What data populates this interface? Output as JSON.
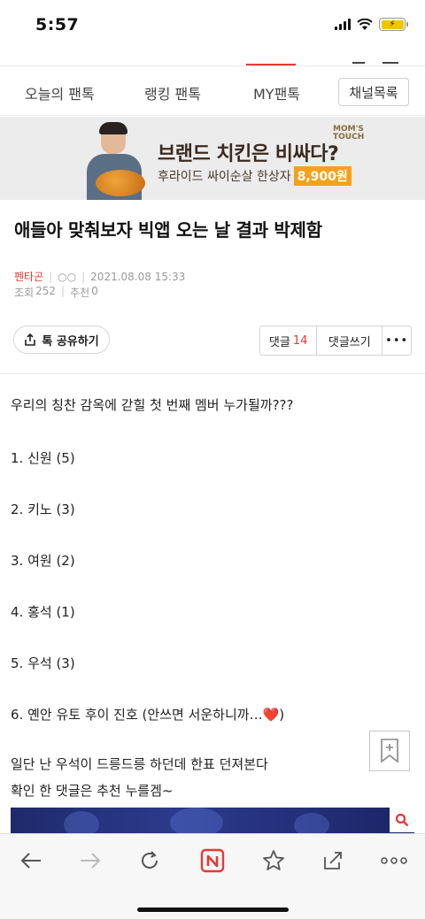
{
  "status": {
    "time": "5:57"
  },
  "tabs": {
    "items": [
      {
        "label": "오늘의 팬톡"
      },
      {
        "label": "랭킹 팬톡"
      },
      {
        "label": "MY팬톡"
      }
    ],
    "active_index": 2,
    "channel_button": "채널목록"
  },
  "ad": {
    "logo": "MOM'S TOUCH",
    "headline": "브랜드 치킨은 비싸다?",
    "sub": "후라이드 싸이순살 한상자",
    "price": "8,900원"
  },
  "post": {
    "title": "애들아 맞춰보자 빅앱 오는 날 결과 박제함",
    "author": "펜타곤",
    "author_extra": "○○",
    "date": "2021.08.08 15:33",
    "views_label": "조회",
    "views": "252",
    "recommend_label": "추천",
    "recommend": "0"
  },
  "actions": {
    "share": "톡 공유하기",
    "comment_label": "댓글",
    "comment_count": "14",
    "write_comment": "댓글쓰기",
    "more": "•••"
  },
  "body": {
    "lines": [
      "우리의 칭찬 감옥에 갇힐 첫 번째 멤버 누가될까???",
      "1. 신원 (5)",
      "2. 키노 (3)",
      "3. 여원 (2)",
      "4. 홍석 (1)",
      "5. 우석 (3)",
      "6. 옌안 유토 후이 진호 (안쓰면 서운하니까…❤️)",
      "일단 난 우석이 드릉드릉 하던데 한표 던져본다",
      "확인 한 댓글은 추천 누를겜~"
    ]
  },
  "colors": {
    "accent": "#e53935",
    "ad_price_bg": "#f4a21b"
  },
  "toolbar": {
    "icons": [
      "back-arrow-icon",
      "forward-arrow-icon",
      "reload-icon",
      "naver-home-icon",
      "star-icon",
      "share-icon",
      "more-icon"
    ]
  }
}
